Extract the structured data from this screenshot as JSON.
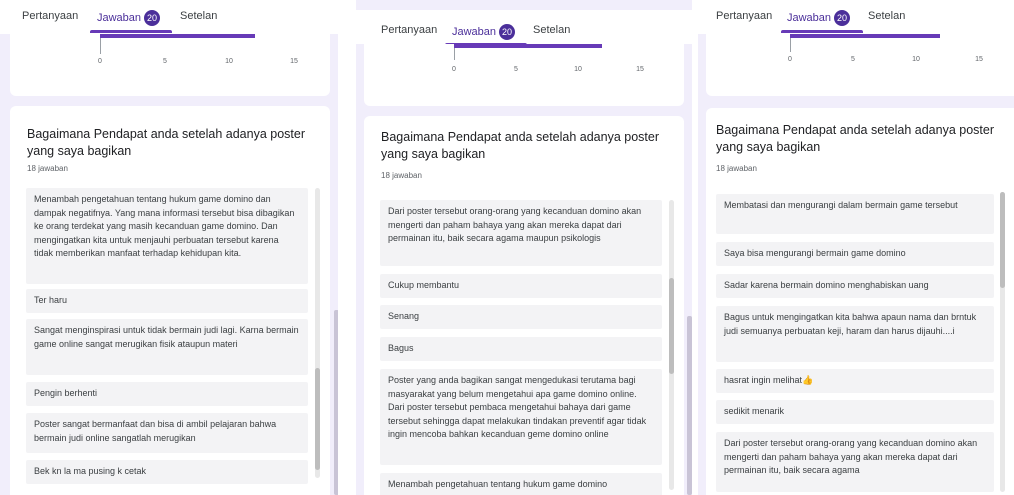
{
  "tabs": {
    "questions": "Pertanyaan",
    "responses": "Jawaban",
    "count": "20",
    "settings": "Setelan"
  },
  "chart": {
    "ticks": [
      "0",
      "5",
      "10",
      "15"
    ],
    "bar_value": 12
  },
  "question": {
    "title": "Bagaimana Pendapat anda setelah adanya poster yang saya bagikan",
    "count": "18 jawaban"
  },
  "panel1": {
    "responses": [
      "Menambah pengetahuan tentang hukum game domino dan dampak negatifnya. Yang mana informasi tersebut bisa dibagikan ke orang terdekat yang masih kecanduan game domino. Dan mengingatkan kita untuk menjauhi perbuatan tersebut karena tidak memberikan manfaat terhadap kehidupan kita.",
      "Ter haru",
      "Sangat menginspirasi untuk tidak bermain judi lagi. Karna bermain game online sangat merugikan fisik ataupun materi",
      "Pengin berhenti",
      "Poster sangat bermanfaat dan bisa di ambil pelajaran bahwa bermain judi online sangatlah merugikan",
      "Bek kn la ma pusing k cetak"
    ]
  },
  "panel2": {
    "responses": [
      "Dari poster tersebut orang-orang yang kecanduan domino akan mengerti dan paham bahaya yang akan mereka dapat dari permainan itu, baik secara agama maupun psikologis",
      "Cukup membantu",
      "Senang",
      "Bagus",
      "Poster yang anda bagikan sangat mengedukasi terutama bagi masyarakat yang belum mengetahui apa game domino online. Dari poster tersebut pembaca mengetahui bahaya dari game tersebut sehingga dapat melakukan tindakan preventif agar tidak ingin mencoba bahkan kecanduan geme domino online",
      "Menambah pengetahuan tentang hukum game domino"
    ]
  },
  "panel3": {
    "responses": [
      "Membatasi dan mengurangi dalam bermain game tersebut",
      "Saya bisa mengurangi bermain game domino",
      "Sadar karena bermain domino menghabiskan uang",
      "Bagus untuk mengingatkan kita bahwa apaun nama dan brntuk judi semuanya perbuatan keji, haram dan harus dijauhi....i",
      "hasrat ingin melihat👍",
      "sedikit menarik",
      "Dari poster tersebut orang-orang yang kecanduan domino akan mengerti dan paham bahaya yang akan mereka dapat dari permainan itu, baik secara agama"
    ]
  },
  "colors": {
    "accent": "#673ab7",
    "badge": "#4b2f9a",
    "panel_bg": "#f1eefb"
  }
}
